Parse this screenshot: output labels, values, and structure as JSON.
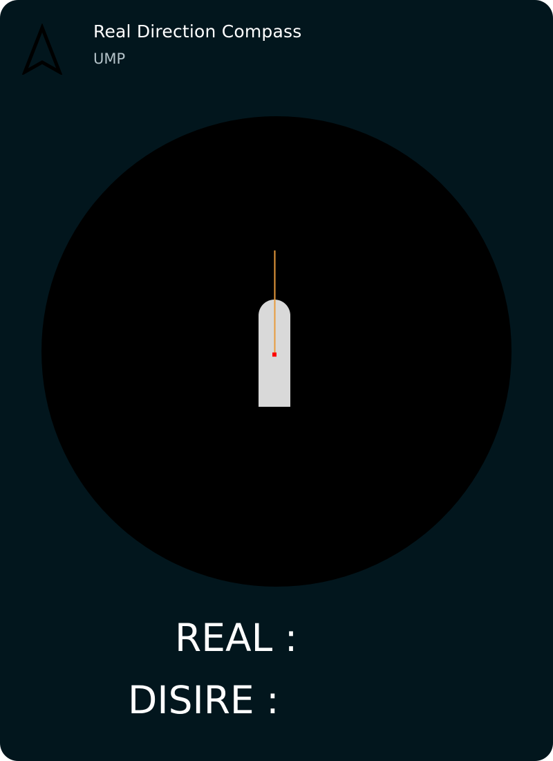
{
  "header": {
    "title": "Real Direction Compass",
    "subtitle": "UMP",
    "icon": "navigation-arrow-icon"
  },
  "compass": {
    "dial_color": "#000000",
    "boat_color": "#d9d9d9",
    "needle_color": "#e89a3c",
    "center_marker_color": "#ff0000"
  },
  "readouts": {
    "real_label": "REAL :",
    "desire_label": "DISIRE :"
  },
  "colors": {
    "background": "#02161d",
    "text": "#ffffff",
    "subtitle": "#b4c3c9"
  }
}
